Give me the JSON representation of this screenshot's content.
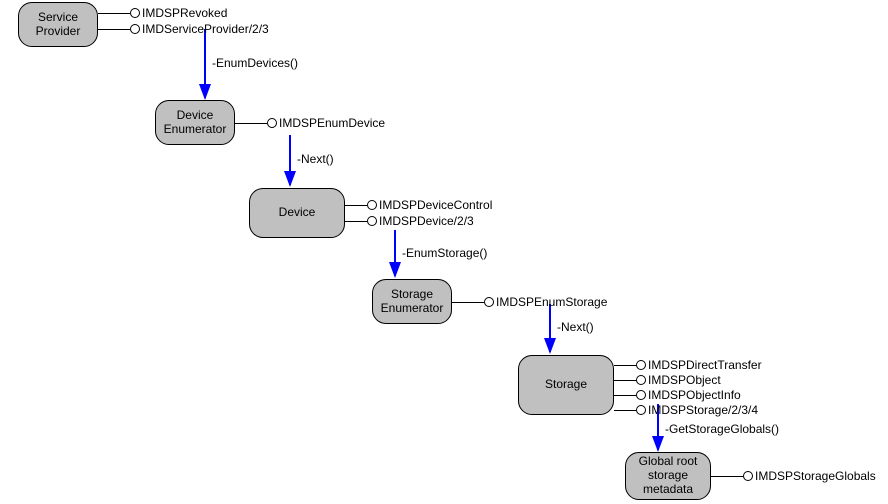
{
  "nodes": {
    "service_provider": "Service\nProvider",
    "device_enumerator": "Device\nEnumerator",
    "device": "Device",
    "storage_enumerator": "Storage\nEnumerator",
    "storage": "Storage",
    "global_root": "Global root\nstorage\nmetadata"
  },
  "interfaces": {
    "sp1": "IMDSPRevoked",
    "sp2": "IMDServiceProvider/2/3",
    "de1": "IMDSPEnumDevice",
    "dv1": "IMDSPDeviceControl",
    "dv2": "IMDSPDevice/2/3",
    "se1": "IMDSPEnumStorage",
    "st1": "IMDSPDirectTransfer",
    "st2": "IMDSPObject",
    "st3": "IMDSPObjectInfo",
    "st4": "IMDSPStorage/2/3/4",
    "gr1": "IMDSPStorageGlobals"
  },
  "methods": {
    "m1": "-EnumDevices()",
    "m2": "-Next()",
    "m3": "-EnumStorage()",
    "m4": "-Next()",
    "m5": "-GetStorageGlobals()"
  }
}
